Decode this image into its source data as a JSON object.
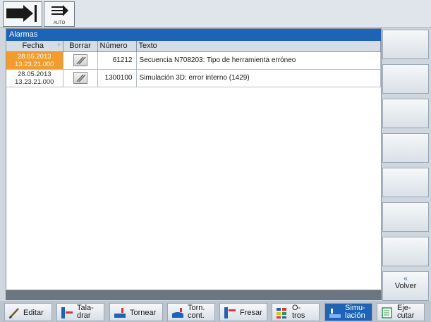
{
  "top": {
    "mode2_label": "AUTO"
  },
  "alarms": {
    "title": "Alarmas",
    "columns": [
      "Fecha",
      "Borrar",
      "Número",
      "Texto"
    ],
    "rows": [
      {
        "date": "28.05.2013",
        "time": "13.23.21.000",
        "number": "61212",
        "text": "Secuencia N708203: Tipo de herramienta erróneo",
        "active": true
      },
      {
        "date": "28.05.2013",
        "time": "13.23.21.000",
        "number": "1300100",
        "text": "Simulación 3D: error interno (1429)",
        "active": false
      }
    ]
  },
  "side_keys": {
    "back_arrow": "«",
    "back": "Volver"
  },
  "bottom_keys": {
    "edit": "Editar",
    "drill_1": "Tala-",
    "drill_2": "drar",
    "turn": "Tornear",
    "contour_1": "Torn.",
    "contour_2": "cont.",
    "mill": "Fresar",
    "others_1": "O-",
    "others_2": "tros",
    "sim_1": "Simu-",
    "sim_2": "lación",
    "exec_1": "Eje-",
    "exec_2": "cutar"
  },
  "colors": {
    "accent": "#1d63b8",
    "active_alarm": "#f39c2b"
  }
}
